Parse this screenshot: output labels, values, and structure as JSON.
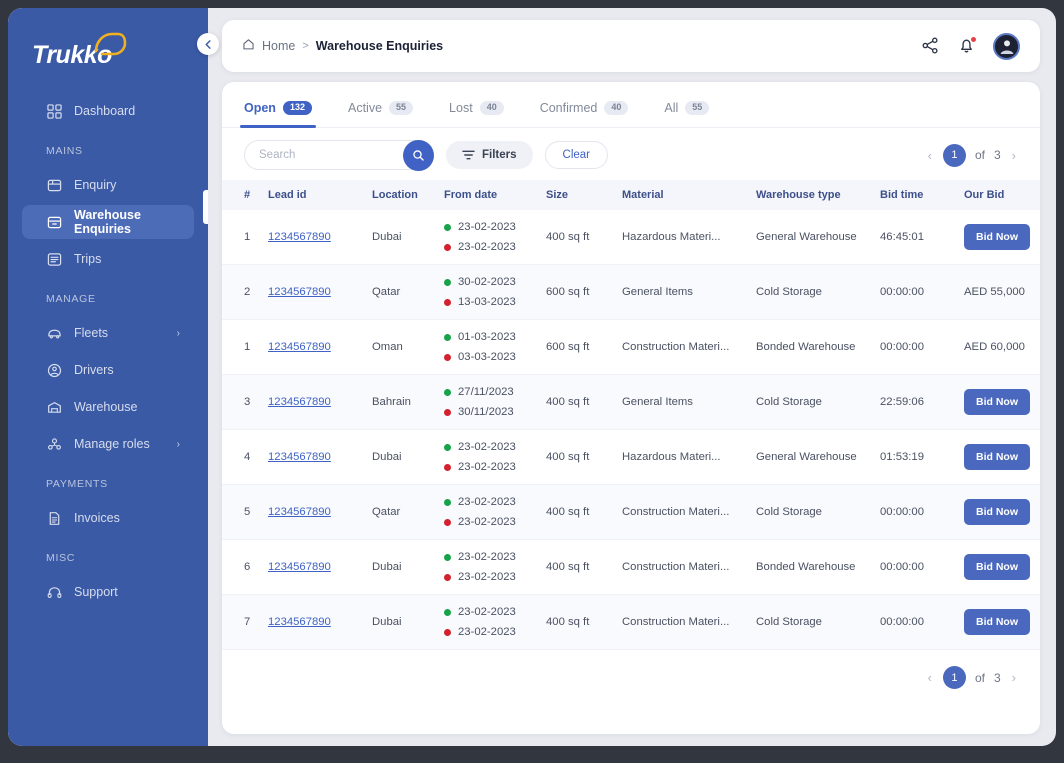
{
  "sidebar": {
    "logo": "Trukko",
    "collapse_icon": "chevron-left-icon",
    "groups": [
      {
        "label": null,
        "items": [
          {
            "label": "Dashboard",
            "icon": "grid-icon",
            "active": false,
            "chevron": false
          }
        ]
      },
      {
        "label": "MAINS",
        "items": [
          {
            "label": "Enquiry",
            "icon": "inbox-icon",
            "active": false,
            "chevron": false
          },
          {
            "label": "Warehouse Enquiries",
            "icon": "archive-icon",
            "active": true,
            "chevron": false
          },
          {
            "label": "Trips",
            "icon": "list-icon",
            "active": false,
            "chevron": false
          }
        ]
      },
      {
        "label": "MANAGE",
        "items": [
          {
            "label": "Fleets",
            "icon": "truck-icon",
            "active": false,
            "chevron": true
          },
          {
            "label": "Drivers",
            "icon": "user-circle-icon",
            "active": false,
            "chevron": false
          },
          {
            "label": "Warehouse",
            "icon": "warehouse-icon",
            "active": false,
            "chevron": false
          },
          {
            "label": "Manage roles",
            "icon": "users-icon",
            "active": false,
            "chevron": true
          }
        ]
      },
      {
        "label": "PAYMENTS",
        "items": [
          {
            "label": "Invoices",
            "icon": "document-icon",
            "active": false,
            "chevron": false
          }
        ]
      },
      {
        "label": "MISC",
        "items": [
          {
            "label": "Support",
            "icon": "headset-icon",
            "active": false,
            "chevron": false
          }
        ]
      }
    ]
  },
  "header": {
    "breadcrumb_home": "Home",
    "breadcrumb_separator": ">",
    "breadcrumb_current": "Warehouse Enquiries",
    "home_icon": "home-icon",
    "share_icon": "share-nodes-icon",
    "bell_icon": "bell-icon",
    "avatar_icon": "user-avatar"
  },
  "tabs": [
    {
      "label": "Open",
      "count": "132",
      "active": true
    },
    {
      "label": "Active",
      "count": "55",
      "active": false
    },
    {
      "label": "Lost",
      "count": "40",
      "active": false
    },
    {
      "label": "Confirmed",
      "count": "40",
      "active": false
    },
    {
      "label": "All",
      "count": "55",
      "active": false
    }
  ],
  "toolbar": {
    "search_placeholder": "Search",
    "search_value": "",
    "search_icon": "magnifier-icon",
    "filters_label": "Filters",
    "filters_icon": "filter-icon",
    "clear_label": "Clear"
  },
  "pagination": {
    "prev_icon": "chevron-left-icon",
    "next_icon": "chevron-right-icon",
    "current": "1",
    "of_label": "of",
    "total": "3"
  },
  "table": {
    "columns": [
      "#",
      "Lead id",
      "Location",
      "From date",
      "Size",
      "Material",
      "Warehouse type",
      "Bid time",
      "Our Bid"
    ],
    "rows": [
      {
        "n": "1",
        "lead": "1234567890",
        "location": "Dubai",
        "from": "23-02-2023",
        "to": "23-02-2023",
        "size": "400 sq ft",
        "material": "Hazardous Materi...",
        "wtype": "General Warehouse",
        "bidtime": "46:45:01",
        "bid_type": "button",
        "bid_label": "Bid Now",
        "alt": false
      },
      {
        "n": "2",
        "lead": "1234567890",
        "location": "Qatar",
        "from": "30-02-2023",
        "to": "13-03-2023",
        "size": "600 sq ft",
        "material": "General Items",
        "wtype": "Cold Storage",
        "bidtime": "00:00:00",
        "bid_type": "amount",
        "bid_label": "AED 55,000",
        "alt": true
      },
      {
        "n": "1",
        "lead": "1234567890",
        "location": "Oman",
        "from": "01-03-2023",
        "to": "03-03-2023",
        "size": "600 sq ft",
        "material": "Construction Materi...",
        "wtype": "Bonded Warehouse",
        "bidtime": "00:00:00",
        "bid_type": "amount",
        "bid_label": "AED 60,000",
        "alt": false
      },
      {
        "n": "3",
        "lead": "1234567890",
        "location": "Bahrain",
        "from": "27/11/2023",
        "to": "30/11/2023",
        "size": "400 sq ft",
        "material": "General Items",
        "wtype": "Cold Storage",
        "bidtime": "22:59:06",
        "bid_type": "button",
        "bid_label": "Bid Now",
        "alt": true
      },
      {
        "n": "4",
        "lead": "1234567890",
        "location": "Dubai",
        "from": "23-02-2023",
        "to": "23-02-2023",
        "size": "400 sq ft",
        "material": "Hazardous Materi...",
        "wtype": "General Warehouse",
        "bidtime": "01:53:19",
        "bid_type": "button",
        "bid_label": "Bid Now",
        "alt": false
      },
      {
        "n": "5",
        "lead": "1234567890",
        "location": "Qatar",
        "from": "23-02-2023",
        "to": "23-02-2023",
        "size": "400 sq ft",
        "material": "Construction Materi...",
        "wtype": "Cold Storage",
        "bidtime": "00:00:00",
        "bid_type": "button",
        "bid_label": "Bid Now",
        "alt": true
      },
      {
        "n": "6",
        "lead": "1234567890",
        "location": "Dubai",
        "from": "23-02-2023",
        "to": "23-02-2023",
        "size": "400 sq ft",
        "material": "Construction Materi...",
        "wtype": "Bonded Warehouse",
        "bidtime": "00:00:00",
        "bid_type": "button",
        "bid_label": "Bid Now",
        "alt": false
      },
      {
        "n": "7",
        "lead": "1234567890",
        "location": "Dubai",
        "from": "23-02-2023",
        "to": "23-02-2023",
        "size": "400 sq ft",
        "material": "Construction Materi...",
        "wtype": "Cold Storage",
        "bidtime": "00:00:00",
        "bid_type": "button",
        "bid_label": "Bid Now",
        "alt": true
      }
    ]
  },
  "colors": {
    "sidebar": "#3b5aa6",
    "accent": "#3f62c4",
    "bid_button": "#4a68bd",
    "logo_truck": "#f2b01e",
    "dot_start": "#16a34a",
    "dot_end": "#d3212e",
    "page_bg": "#e9eaf0",
    "outer_frame": "#32363e"
  }
}
